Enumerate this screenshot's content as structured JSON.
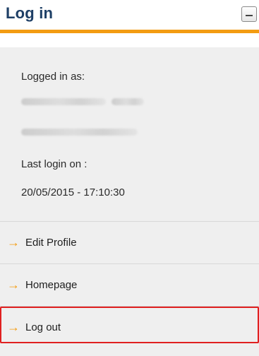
{
  "widget": {
    "title": "Log in",
    "minimize_icon": "minus-icon"
  },
  "session": {
    "logged_in_label": "Logged in as:",
    "last_login_label": "Last login on :",
    "last_login_value": "20/05/2015 - 17:10:30"
  },
  "links": [
    {
      "label": "Edit Profile",
      "icon": "arrow-right-icon"
    },
    {
      "label": "Homepage",
      "icon": "arrow-right-icon"
    },
    {
      "label": "Log out",
      "icon": "arrow-right-icon"
    }
  ],
  "colors": {
    "accent": "#f39c12",
    "title": "#1e3f66",
    "highlight": "#e02020",
    "panel": "#efefef"
  }
}
